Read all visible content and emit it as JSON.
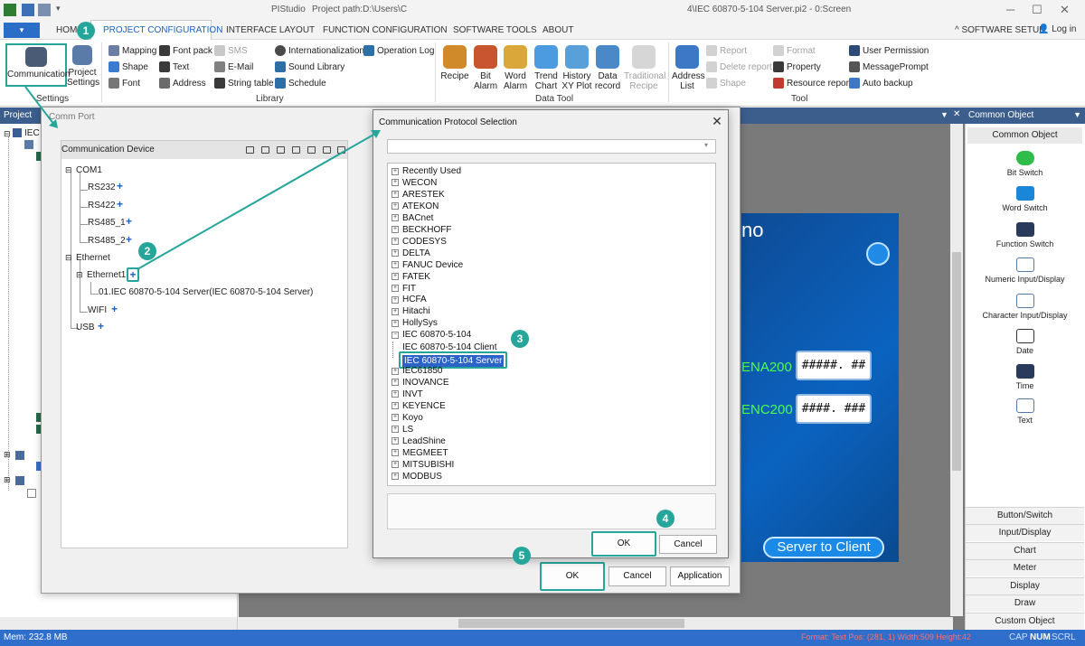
{
  "window": {
    "app_name": "PIStudio",
    "path_prefix": "Project path:D:\\Users\\C",
    "path_suffix": "4\\IEC 60870-5-104 Server.pi2 - 0:Screen"
  },
  "menu": {
    "home": "HOME",
    "tabs": [
      "PROJECT CONFIGURATION",
      "INTERFACE LAYOUT",
      "FUNCTION CONFIGURATION",
      "SOFTWARE TOOLS",
      "ABOUT"
    ],
    "software_setup": "SOFTWARE SETUP",
    "login": "Log in"
  },
  "ribbon": {
    "settings": {
      "communication": "Communication",
      "project_settings_1": "Project",
      "project_settings_2": "Settings",
      "group": "Settings"
    },
    "library": {
      "items": [
        {
          "label": "Mapping",
          "icon": "mapping-icon"
        },
        {
          "label": "Font pack",
          "icon": "font-pack-icon"
        },
        {
          "label": "SMS",
          "icon": "sms-icon",
          "disabled": true
        },
        {
          "label": "Internationalization",
          "icon": "globe-icon"
        },
        {
          "label": "Operation Log",
          "icon": "operation-log-icon"
        },
        {
          "label": "Shape",
          "icon": "shape-icon"
        },
        {
          "label": "Text",
          "icon": "text-icon"
        },
        {
          "label": "E-Mail",
          "icon": "email-icon"
        },
        {
          "label": "Sound Library",
          "icon": "sound-icon"
        },
        {
          "label": "Font",
          "icon": "font-icon"
        },
        {
          "label": "Address",
          "icon": "address-icon"
        },
        {
          "label": "String table",
          "icon": "string-table-icon"
        },
        {
          "label": "Schedule",
          "icon": "schedule-icon"
        }
      ],
      "group": "Library"
    },
    "datatool": {
      "items": [
        {
          "l1": "Recipe",
          "l2": ""
        },
        {
          "l1": "Bit",
          "l2": "Alarm"
        },
        {
          "l1": "Word",
          "l2": "Alarm"
        },
        {
          "l1": "Trend",
          "l2": "Chart"
        },
        {
          "l1": "History",
          "l2": "XY Plot"
        },
        {
          "l1": "Data",
          "l2": "record"
        },
        {
          "l1": "Traditional",
          "l2": "Recipe"
        }
      ],
      "group": "Data Tool"
    },
    "tool": {
      "address_list_1": "Address",
      "address_list_2": "List",
      "items": [
        "Report",
        "Delete report",
        "Shape",
        "Format",
        "Property",
        "Resource report",
        "User Permission",
        "MessagePrompt",
        "Auto backup"
      ],
      "group": "Tool"
    }
  },
  "panels": {
    "project": "Project",
    "project_root": "IEC",
    "common_object_header": "Common Object",
    "common_object_title": "Common Object",
    "common_objects": [
      "Bit Switch",
      "Word Switch",
      "Function Switch",
      "Numeric Input/Display",
      "Character Input/Display",
      "Date",
      "Time",
      "Text"
    ],
    "categories": [
      "Button/Switch",
      "Input/Display",
      "Chart",
      "Meter",
      "Display",
      "Draw",
      "Custom Object"
    ]
  },
  "canvas": {
    "title_fragment": "no",
    "label1": "ENA200",
    "value1": "#####. ##",
    "label2": "ENC200",
    "value2": "####. ###",
    "button": "Server to Client"
  },
  "comm_dialog": {
    "title": "Comm Port",
    "device_header": "Communication Device",
    "tree": {
      "com1": "COM1",
      "rs232": "RS232",
      "rs422": "RS422",
      "rs485_1": "RS485_1",
      "rs485_2": "RS485_2",
      "ethernet": "Ethernet",
      "ethernet1": "Ethernet1",
      "device": "01.IEC 60870-5-104 Server(IEC 60870-5-104 Server)",
      "wifi": "WIFI",
      "usb": "USB"
    },
    "ok": "OK",
    "cancel": "Cancel",
    "application": "Application"
  },
  "protocol_dialog": {
    "title": "Communication Protocol Selection",
    "combo_value": "",
    "vendors": [
      "Recently Used",
      "WECON",
      "ARESTEK",
      "ATEKON",
      "BACnet",
      "BECKHOFF",
      "CODESYS",
      "DELTA",
      "FANUC Device",
      "FATEK",
      "FIT",
      "HCFA",
      "Hitachi",
      "HollySys",
      "IEC 60870-5-104"
    ],
    "sub_client": "IEC 60870-5-104 Client",
    "sub_server": "IEC 60870-5-104 Server",
    "vendors_after": [
      "IEC61850",
      "INOVANCE",
      "INVT",
      "KEYENCE",
      "Koyo",
      "LS",
      "LeadShine",
      "MEGMEET",
      "MITSUBISHI",
      "MODBUS"
    ],
    "ok": "OK",
    "cancel": "Cancel"
  },
  "steps": [
    "1",
    "2",
    "3",
    "4",
    "5"
  ],
  "status": {
    "mem": "Mem: 232.8 MB",
    "format": "Format: Text  Pos: (281, 1) Width:509 Height:42",
    "caps": [
      "CAP",
      "NUM",
      "SCRL"
    ]
  },
  "colors": {
    "accent": "#26a69a",
    "ribbon_blue": "#1a62c0",
    "panel_header": "#3c5e8c",
    "statusbar": "#2f6fcb"
  }
}
